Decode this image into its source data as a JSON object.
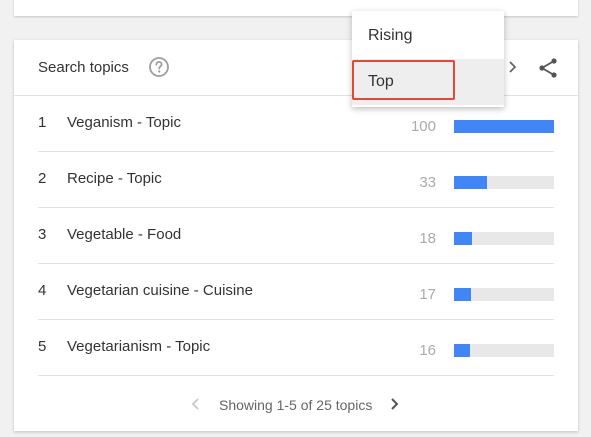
{
  "card": {
    "title": "Search topics",
    "help_icon": "help-circle-icon",
    "share_icon": "share-icon"
  },
  "menu": {
    "items": [
      {
        "label": "Rising"
      },
      {
        "label": "Top",
        "selected": true
      }
    ],
    "highlight_color": "#e0483a"
  },
  "topics": [
    {
      "rank": "1",
      "name": "Veganism - Topic",
      "value": "100"
    },
    {
      "rank": "2",
      "name": "Recipe - Topic",
      "value": "33"
    },
    {
      "rank": "3",
      "name": "Vegetable - Food",
      "value": "18"
    },
    {
      "rank": "4",
      "name": "Vegetarian cuisine - Cuisine",
      "value": "17"
    },
    {
      "rank": "5",
      "name": "Vegetarianism - Topic",
      "value": "16"
    }
  ],
  "bar_color": "#4285f4",
  "footer": {
    "text": "Showing 1-5 of 25 topics"
  }
}
